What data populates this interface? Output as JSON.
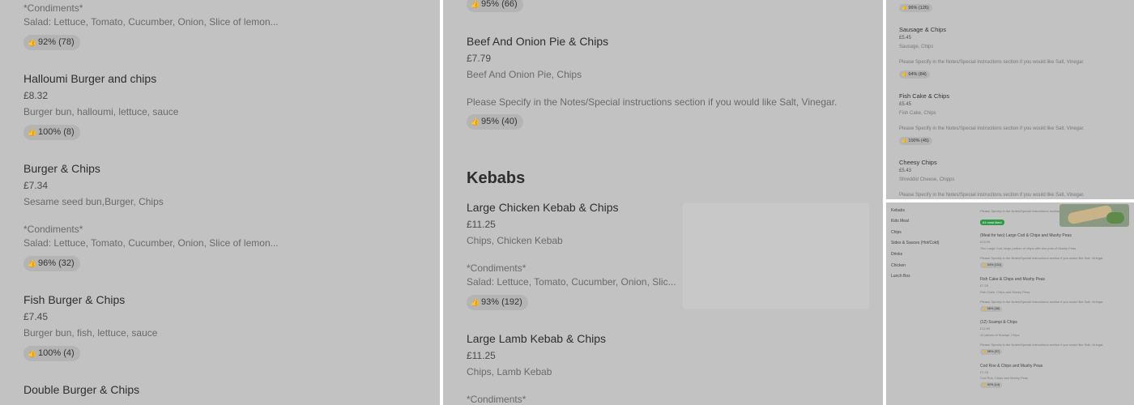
{
  "panel1": {
    "top_condiments_label": "*Condiments*",
    "top_condiments_text": "Salad: Lettuce, Tomato, Cucumber, Onion, Slice of lemon...",
    "top_rating": "92% (78)",
    "items": [
      {
        "name": "Halloumi Burger and chips",
        "price": "£8.32",
        "desc": "Burger bun, halloumi, lettuce, sauce",
        "rating": "100% (8)"
      },
      {
        "name": "Burger & Chips",
        "price": "£7.34",
        "desc": "Sesame seed bun,Burger, Chips",
        "condiments_label": "*Condiments*",
        "condiments_text": "Salad: Lettuce, Tomato, Cucumber, Onion, Slice of lemon...",
        "rating": "96% (32)"
      },
      {
        "name": "Fish Burger & Chips",
        "price": "£7.45",
        "desc": "Burger bun, fish, lettuce, sauce",
        "rating": "100% (4)"
      },
      {
        "name": "Double Burger & Chips"
      }
    ]
  },
  "panel2": {
    "top_rating": "95% (66)",
    "pie": {
      "name": "Beef And Onion Pie & Chips",
      "price": "£7.79",
      "desc": "Beef And Onion Pie, Chips",
      "note": "Please Specify in the Notes/Special instructions section if you would like Salt, Vinegar.",
      "rating": "95% (40)"
    },
    "section_title": "Kebabs",
    "chicken": {
      "name": "Large Chicken Kebab & Chips",
      "price": "£11.25",
      "desc": "Chips, Chicken Kebab",
      "condiments_label": "*Condiments*",
      "condiments_text": "Salad: Lettuce, Tomato, Cucumber, Onion, Slic...",
      "rating": "93% (192)"
    },
    "lamb": {
      "name": "Large Lamb Kebab & Chips",
      "price": "£11.25",
      "desc": "Chips, Lamb Kebab",
      "condiments_label": "*Condiments*"
    }
  },
  "panel3": {
    "top_rating": "96% (126)",
    "items": [
      {
        "name": "Sausage & Chips",
        "price": "£5.45",
        "desc": "Sausage, Chips",
        "note": "Please Specify in the Notes/Special instructions section if you would like Salt, Vinegar.",
        "rating": "94% (84)"
      },
      {
        "name": "Fish Cake & Chips",
        "price": "£5.45",
        "desc": "Fish Cake, Chips",
        "note": "Please Specify in the Notes/Special instructions section if you would like Salt, Vinegar.",
        "rating": "100% (45)"
      },
      {
        "name": "Cheesy Chips",
        "price": "£5.43",
        "desc": "Shreddid Cheese, Chipps",
        "note": "Please Specify in the Notes/Special instructions section if you would like Salt, Vinegar."
      }
    ]
  },
  "panel4": {
    "categories": [
      "Kebabs",
      "Kids Meal",
      "Chips",
      "Sides & Sauces (Hot/Cold)",
      "Drinks",
      "Chicken",
      "Lunch Box"
    ],
    "top_note": "Please Specify in the Notes/Special instructions section if you would like Salt...",
    "badge": "#1 most liked",
    "items": [
      {
        "name": "(Meal for two) Large Cod & Chips and Mushy Peas",
        "price": "£23.99",
        "desc": "Two Large Cod, large portion of chips with two pots of Mushy Peas.",
        "note": "Please Specify in the Notes/Special instructions section if you would like Salt, Vinegar.",
        "rating": "94% (151)"
      },
      {
        "name": "Fish Cake & Chips and Mushy Peas",
        "price": "£7.25",
        "desc": "Fish Cake, Chips and Mushy Peas",
        "note": "Please Specify in the Notes/Special instructions section if you would like Salt, Vinegar.",
        "rating": "96% (38)"
      },
      {
        "name": "(12) Scampi & Chips",
        "price": "£12.69",
        "desc": "12 pieces of Scampi, Chips",
        "note": "Please Specify in the Notes/Special instructions section if you would like Salt, Vinegar.",
        "rating": "98% (97)"
      },
      {
        "name": "Cod Roe & Chips and Mushy Peas",
        "price": "£7.25",
        "desc": "Cod Roe, Chips and Mushy Peas",
        "rating": "92% (14)"
      }
    ]
  },
  "icons": {
    "rating": "thumbs-up-icon"
  }
}
